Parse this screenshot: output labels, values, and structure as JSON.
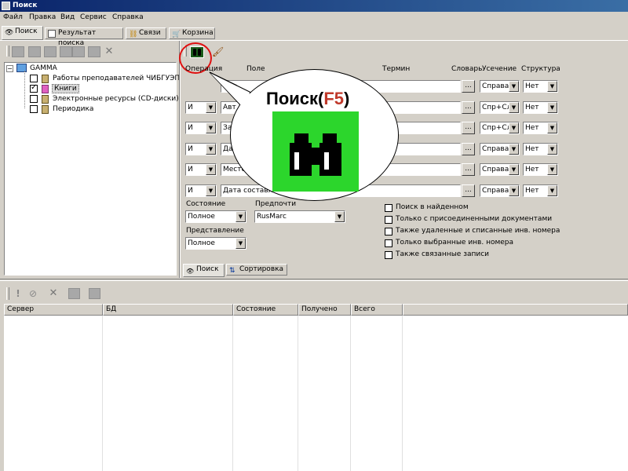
{
  "window": {
    "title": "Поиск"
  },
  "menu": [
    "Файл",
    "Правка",
    "Вид",
    "Сервис",
    "Справка"
  ],
  "tabs": [
    "Поиск",
    "Результат поиска",
    "Связи",
    "Корзина"
  ],
  "tree": {
    "root": "GAMMA",
    "items": [
      {
        "label": "Работы преподавателей ЧИБГУЭП",
        "checked": false
      },
      {
        "label": "Книги",
        "checked": true
      },
      {
        "label": "Электронные ресурсы (CD-диски)",
        "checked": false
      },
      {
        "label": "Периодика",
        "checked": false
      }
    ]
  },
  "query": {
    "headers": {
      "operation": "Операция",
      "field": "Поле",
      "term": "Термин",
      "dictionary": "Словарь",
      "truncation": "Усечение",
      "structure": "Структура"
    },
    "rows": [
      {
        "op": "",
        "field": "",
        "term": "",
        "trunc": "Справа",
        "struct": "Нет"
      },
      {
        "op": "И",
        "field": "Авт",
        "term": "",
        "trunc": "Спр+Сл",
        "struct": "Нет"
      },
      {
        "op": "И",
        "field": "За",
        "term": "",
        "trunc": "Спр+Сл",
        "struct": "Нет"
      },
      {
        "op": "И",
        "field": "Дат",
        "term": "",
        "trunc": "Справа",
        "struct": "Нет"
      },
      {
        "op": "И",
        "field": "Место",
        "term": "",
        "trunc": "Справа",
        "struct": "Нет"
      },
      {
        "op": "И",
        "field": "Дата составл",
        "term": "",
        "trunc": "Справа",
        "struct": "Нет"
      }
    ],
    "dots": "..."
  },
  "state": {
    "label": "Состояние",
    "value": "Полное"
  },
  "preferred": {
    "label": "Предпочти",
    "value": "RusMarc"
  },
  "representation": {
    "label": "Представление",
    "value": "Полное"
  },
  "options": [
    {
      "label": "Поиск в найденном",
      "checked": false
    },
    {
      "label": "Только с присоединенными документами",
      "checked": false
    },
    {
      "label": "Также удаленные и списанные инв. номера",
      "checked": false
    },
    {
      "label": "Только выбранные инв. номера",
      "checked": false
    },
    {
      "label": "Также связанные записи",
      "checked": false
    }
  ],
  "bottom_tabs": [
    "Поиск",
    "Сортировка"
  ],
  "grid": {
    "columns": [
      "Сервер",
      "БД",
      "Состояние",
      "Получено",
      "Всего"
    ]
  },
  "callout": {
    "title_prefix": "Поиск(",
    "key": "F5",
    "title_suffix": ")"
  },
  "colors": {
    "titlebar": "#0a246a",
    "callout_key": "#c0392b",
    "highlight_ring": "#e01010",
    "binoculars_bg": "#22cc22"
  }
}
